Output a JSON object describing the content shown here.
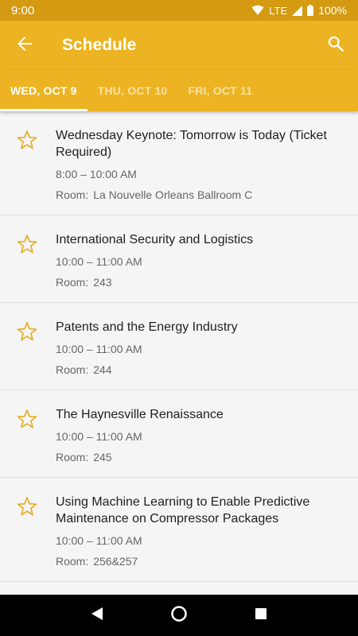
{
  "status_bar": {
    "time": "9:00",
    "network": "LTE",
    "battery": "100%",
    "icons": [
      "wifi-icon",
      "signal-icon",
      "battery-icon"
    ]
  },
  "app_bar": {
    "title": "Schedule",
    "back_icon": "arrow-back-icon",
    "search_icon": "search-icon"
  },
  "tabs": [
    {
      "label": "WED, OCT 9",
      "active": true
    },
    {
      "label": "THU, OCT 10",
      "active": false
    },
    {
      "label": "FRI, OCT 11",
      "active": false
    }
  ],
  "sessions": [
    {
      "title": "Wednesday Keynote: Tomorrow is Today (Ticket Required)",
      "time": "8:00 – 10:00 AM",
      "room_label": "Room:",
      "room": "La Nouvelle Orleans Ballroom C"
    },
    {
      "title": "International Security and Logistics",
      "time": "10:00 – 11:00 AM",
      "room_label": "Room:",
      "room": "243"
    },
    {
      "title": "Patents and the Energy Industry",
      "time": "10:00 – 11:00 AM",
      "room_label": "Room:",
      "room": "244"
    },
    {
      "title": "The Haynesville Renaissance",
      "time": "10:00 – 11:00 AM",
      "room_label": "Room:",
      "room": "245"
    },
    {
      "title": "Using Machine Learning to Enable Predictive Maintenance on Compressor Packages",
      "time": "10:00 – 11:00 AM",
      "room_label": "Room:",
      "room": "256&257"
    }
  ],
  "colors": {
    "status_bar": "#d39a12",
    "app_bar": "#ecb422",
    "star_outline": "#e3b12a",
    "background": "#f5f5f5"
  },
  "nav_bar": {
    "icons": [
      "back-triangle-icon",
      "home-circle-icon",
      "recents-square-icon"
    ]
  }
}
